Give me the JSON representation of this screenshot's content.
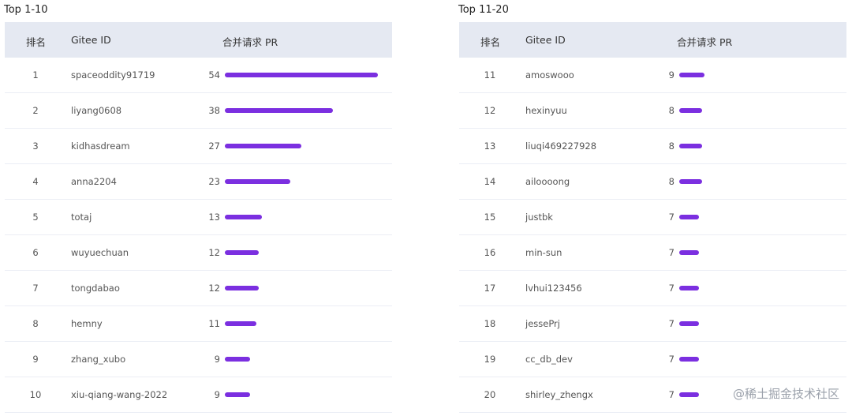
{
  "colors": {
    "header_bg": "#e5e9f2",
    "bar": "#7b2fe0",
    "row_divider": "#ebeef5"
  },
  "headers": {
    "rank": "排名",
    "id": "Gitee ID",
    "pr": "合并请求 PR"
  },
  "panels": [
    {
      "title": "Top 1-10",
      "rows": [
        {
          "rank": "1",
          "id": "spaceoddity91719",
          "pr": 54
        },
        {
          "rank": "2",
          "id": "liyang0608",
          "pr": 38
        },
        {
          "rank": "3",
          "id": "kidhasdream",
          "pr": 27
        },
        {
          "rank": "4",
          "id": "anna2204",
          "pr": 23
        },
        {
          "rank": "5",
          "id": "totaj",
          "pr": 13
        },
        {
          "rank": "6",
          "id": "wuyuechuan",
          "pr": 12
        },
        {
          "rank": "7",
          "id": "tongdabao",
          "pr": 12
        },
        {
          "rank": "8",
          "id": "hemny",
          "pr": 11
        },
        {
          "rank": "9",
          "id": "zhang_xubo",
          "pr": 9
        },
        {
          "rank": "10",
          "id": "xiu-qiang-wang-2022",
          "pr": 9
        }
      ]
    },
    {
      "title": "Top 11-20",
      "rows": [
        {
          "rank": "11",
          "id": "amoswooo",
          "pr": 9
        },
        {
          "rank": "12",
          "id": "hexinyuu",
          "pr": 8
        },
        {
          "rank": "13",
          "id": "liuqi469227928",
          "pr": 8
        },
        {
          "rank": "14",
          "id": "ailoooong",
          "pr": 8
        },
        {
          "rank": "15",
          "id": "justbk",
          "pr": 7
        },
        {
          "rank": "16",
          "id": "min-sun",
          "pr": 7
        },
        {
          "rank": "17",
          "id": "lvhui123456",
          "pr": 7
        },
        {
          "rank": "18",
          "id": "jessePrj",
          "pr": 7
        },
        {
          "rank": "19",
          "id": "cc_db_dev",
          "pr": 7
        },
        {
          "rank": "20",
          "id": "shirley_zhengx",
          "pr": 7
        }
      ]
    }
  ],
  "watermark": "@稀土掘金技术社区"
}
